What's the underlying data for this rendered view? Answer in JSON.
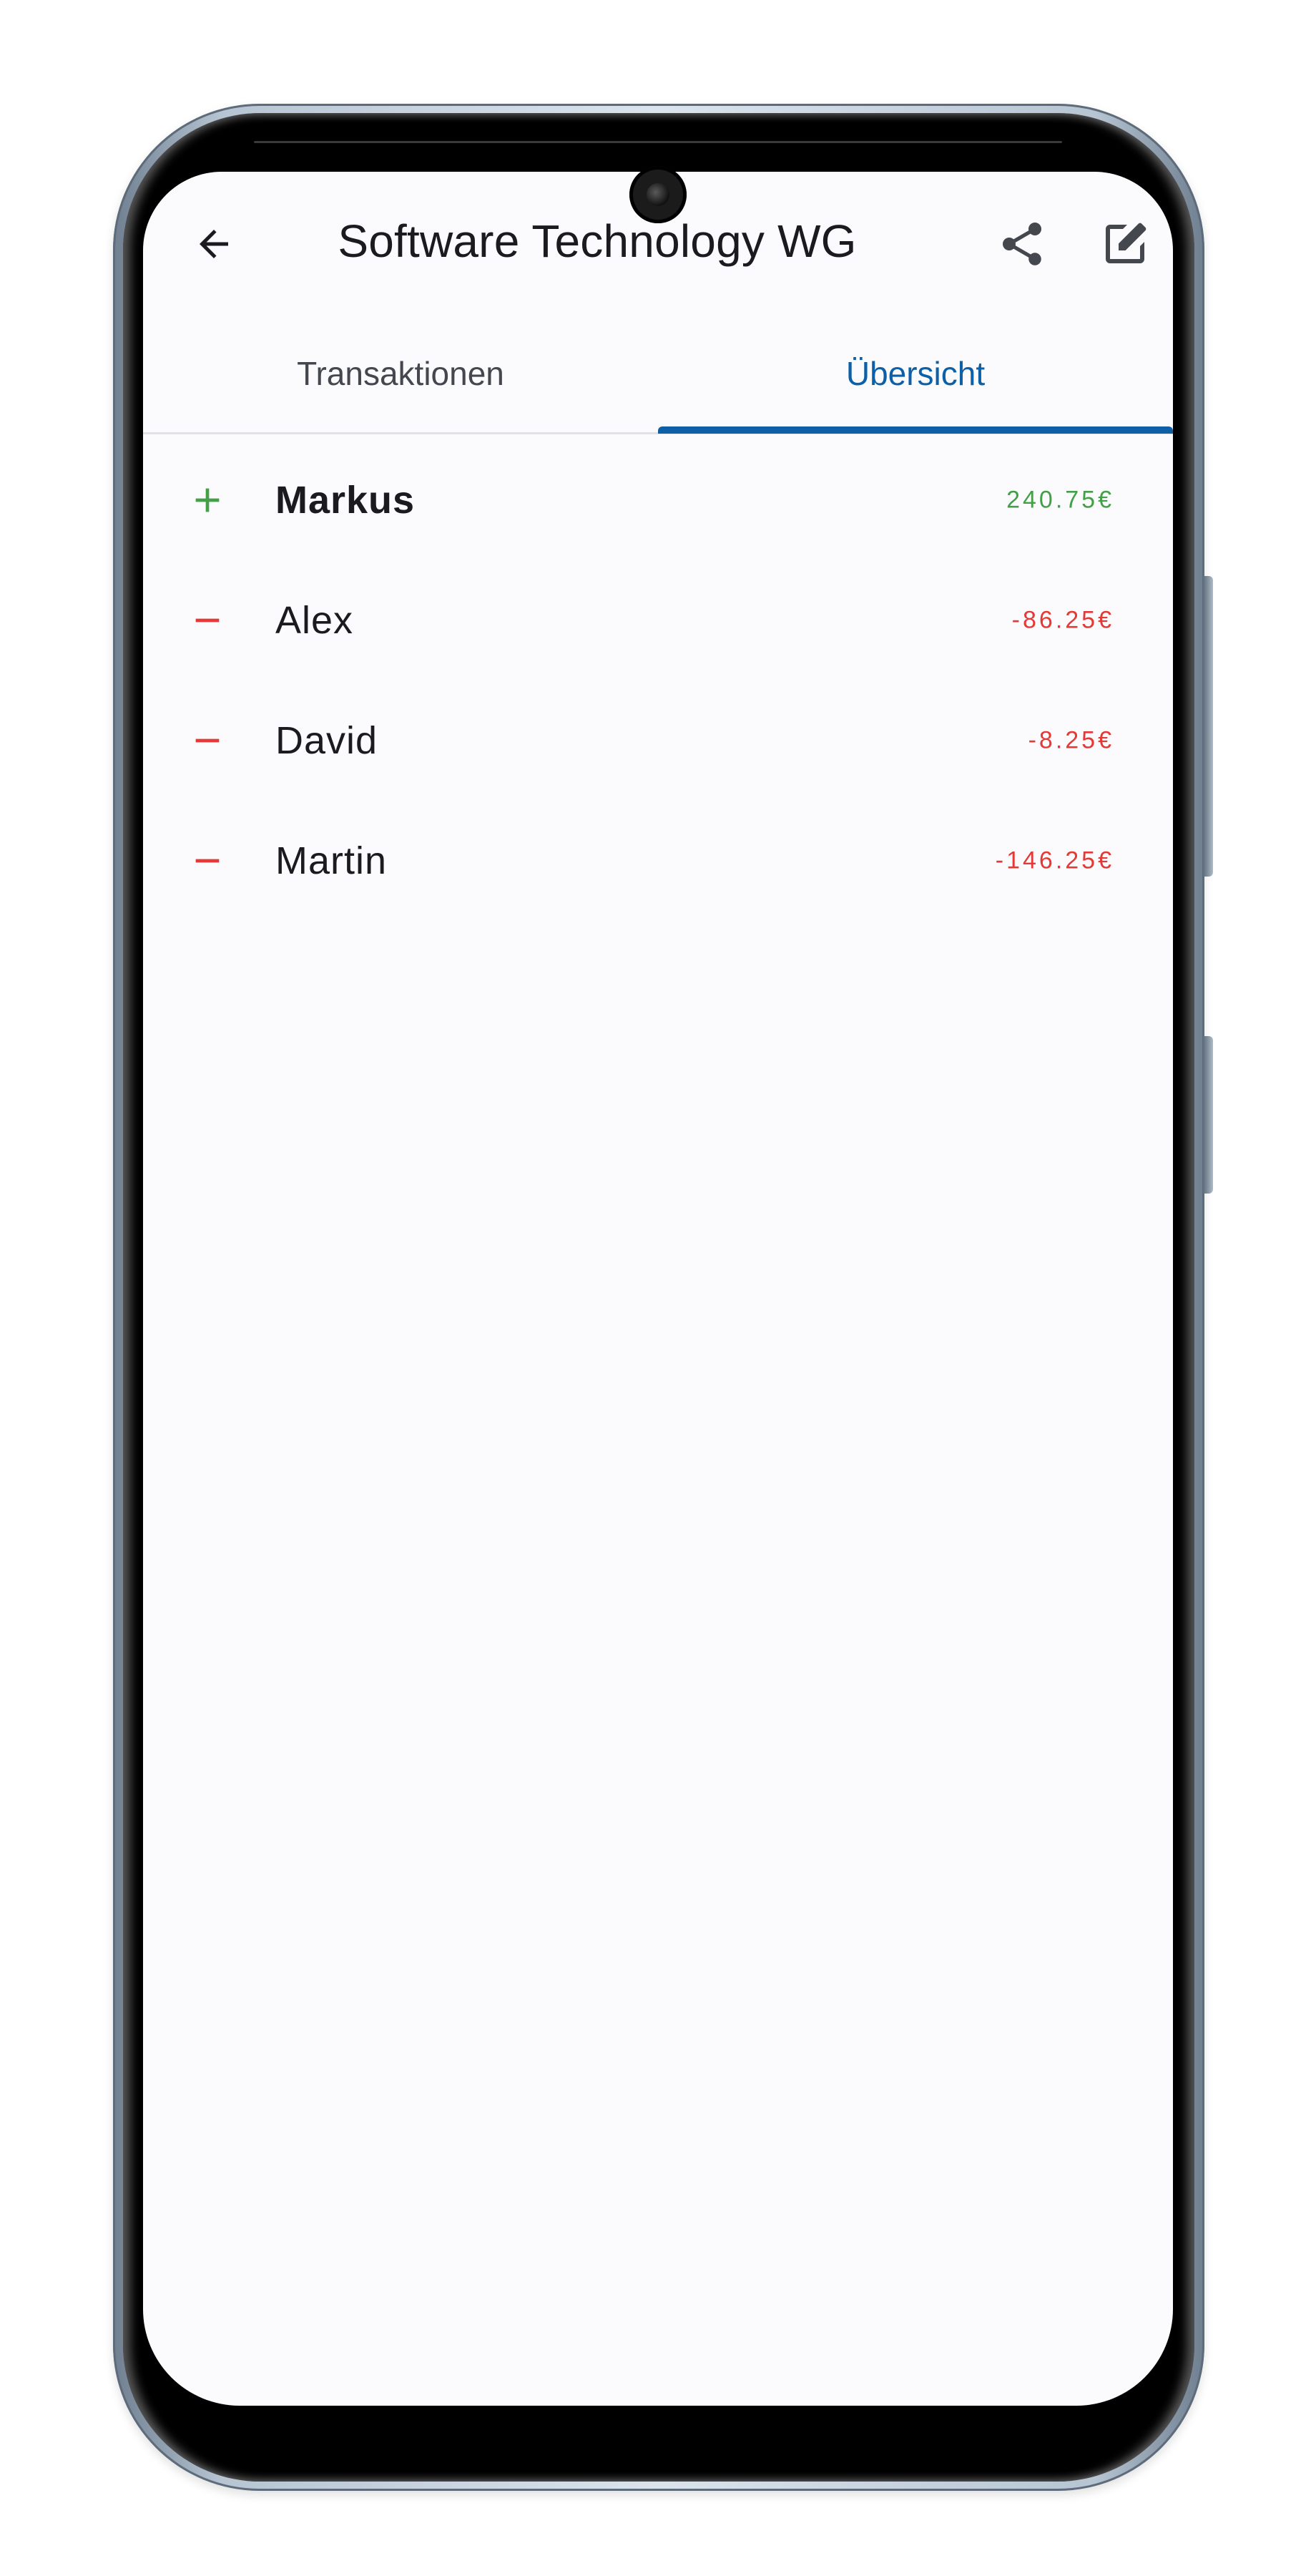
{
  "app_bar": {
    "title": "Software Technology WG",
    "icons": [
      "arrow-back-icon",
      "share-icon",
      "edit-icon"
    ]
  },
  "tabs": [
    {
      "label": "Transaktionen",
      "selected": false
    },
    {
      "label": "Übersicht",
      "selected": true
    }
  ],
  "balances": [
    {
      "name": "Markus",
      "amount": "240.75€",
      "sign": "plus",
      "highlighted": true
    },
    {
      "name": "Alex",
      "amount": "-86.25€",
      "sign": "minus",
      "highlighted": false
    },
    {
      "name": "David",
      "amount": "-8.25€",
      "sign": "minus",
      "highlighted": false
    },
    {
      "name": "Martin",
      "amount": "-146.25€",
      "sign": "minus",
      "highlighted": false
    }
  ],
  "colors": {
    "accent": "#0d5fa6",
    "positive": "#43a047",
    "negative": "#e53935",
    "text": "#1b1b1f",
    "background": "#fbfbfe"
  }
}
